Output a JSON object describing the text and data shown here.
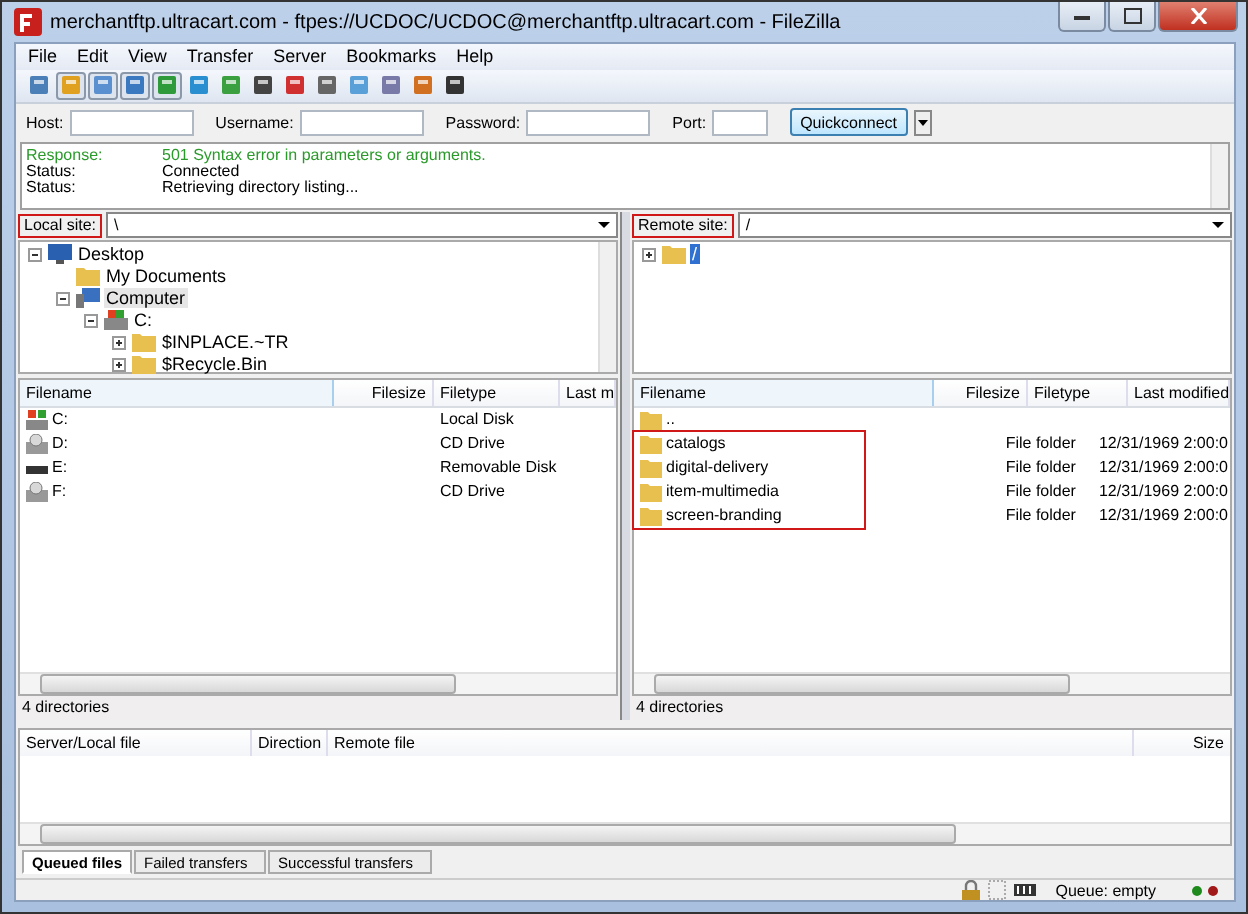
{
  "window": {
    "title": "merchantftp.ultracart.com - ftpes://UCDOC/UCDOC@merchantftp.ultracart.com - FileZilla"
  },
  "menu": [
    "File",
    "Edit",
    "View",
    "Transfer",
    "Server",
    "Bookmarks",
    "Help"
  ],
  "toolbar": [
    {
      "pressed": false
    },
    {
      "pressed": true
    },
    {
      "pressed": true
    },
    {
      "pressed": true
    },
    {
      "pressed": true
    },
    {
      "pressed": false
    },
    {
      "pressed": false
    },
    {
      "pressed": false
    },
    {
      "pressed": false
    },
    {
      "pressed": false
    },
    {
      "pressed": false
    },
    {
      "pressed": false
    },
    {
      "pressed": false
    },
    {
      "pressed": false
    }
  ],
  "quickconnect": {
    "fields": [
      {
        "label": "Host:"
      },
      {
        "label": "Username:"
      },
      {
        "label": "Password:"
      },
      {
        "label": "Port:"
      }
    ],
    "button": "Quickconnect"
  },
  "log": [
    {
      "kind": "response",
      "label": "Response:",
      "text": "501 Syntax error in parameters or arguments."
    },
    {
      "kind": "status",
      "label": "Status:",
      "text": "Connected"
    },
    {
      "kind": "status",
      "label": "Status:",
      "text": "Retrieving directory listing..."
    }
  ],
  "local_site": {
    "label": "Local site:",
    "value": "\\",
    "highlighted": true
  },
  "remote_site": {
    "label": "Remote site:",
    "value": "/",
    "highlighted": true
  },
  "local_tree": [
    {
      "name": "Desktop",
      "kind": "desktop",
      "selected": false,
      "expanded": true,
      "children": [
        {
          "name": "My Documents",
          "kind": "folder",
          "selected": false
        },
        {
          "name": "Computer",
          "kind": "computer",
          "selected": true,
          "expanded": true,
          "children": [
            {
              "name": "C:",
              "kind": "disk",
              "selected": false,
              "expanded": true,
              "children": [
                {
                  "name": "$INPLACE.~TR",
                  "kind": "folder",
                  "selected": false,
                  "expanded": false
                },
                {
                  "name": "$Recycle.Bin",
                  "kind": "folder",
                  "selected": false,
                  "expanded": false
                }
              ]
            }
          ]
        }
      ]
    }
  ],
  "remote_tree": [
    {
      "name": "/",
      "kind": "folder",
      "selected": true,
      "expanded": false
    }
  ],
  "local_files": {
    "columns": [
      "Filename",
      "Filesize",
      "Filetype",
      "Last m"
    ],
    "rows": [
      {
        "kind": "local-disk",
        "name": "C:",
        "type": "Local Disk"
      },
      {
        "kind": "cd-drive",
        "name": "D:",
        "type": "CD Drive"
      },
      {
        "kind": "removable",
        "name": "E:",
        "type": "Removable Disk"
      },
      {
        "kind": "cd-drive",
        "name": "F:",
        "type": "CD Drive"
      }
    ],
    "status": "4 directories"
  },
  "remote_files": {
    "columns": [
      "Filename",
      "Filesize",
      "Filetype",
      "Last modified"
    ],
    "rows": [
      {
        "kind": "folder",
        "name": "..",
        "type": "",
        "modified": "",
        "highlighted": false
      },
      {
        "kind": "folder",
        "name": "catalogs",
        "type": "File folder",
        "modified": "12/31/1969 2:00:0",
        "highlighted": true
      },
      {
        "kind": "folder",
        "name": "digital-delivery",
        "type": "File folder",
        "modified": "12/31/1969 2:00:0",
        "highlighted": true
      },
      {
        "kind": "folder",
        "name": "item-multimedia",
        "type": "File folder",
        "modified": "12/31/1969 2:00:0",
        "highlighted": true
      },
      {
        "kind": "folder",
        "name": "screen-branding",
        "type": "File folder",
        "modified": "12/31/1969 2:00:0",
        "highlighted": true
      }
    ],
    "status": "4 directories"
  },
  "queue": {
    "columns": [
      "Server/Local file",
      "Direction",
      "Remote file",
      "Size"
    ]
  },
  "queue_tabs": [
    {
      "label": "Queued files",
      "selected": true
    },
    {
      "label": "Failed transfers",
      "selected": false
    },
    {
      "label": "Successful transfers",
      "selected": false
    }
  ],
  "status_bar": {
    "queue": "Queue: empty",
    "lights": [
      {
        "color": "#1e8a1e"
      },
      {
        "color": "#a01818"
      }
    ]
  }
}
